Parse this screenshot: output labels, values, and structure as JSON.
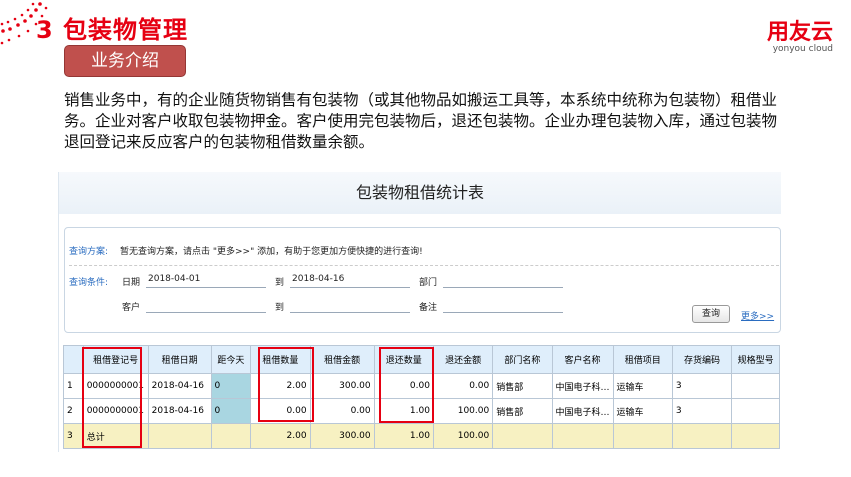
{
  "slide": {
    "title": "3  包装物管理",
    "section_label": "业务介绍",
    "logo_cn": "用友云",
    "logo_en": "yonyou cloud",
    "description": "销售业务中，有的企业随货物销售有包装物（或其他物品如搬运工具等，本系统中统称为包装物）租借业务。企业对客户收取包装物押金。客户使用完包装物后，退还包装物。企业办理包装物入库，通过包装物退回登记来反应客户的包装物租借数量余额。"
  },
  "report": {
    "title": "包装物租借统计表",
    "query": {
      "scheme_label": "查询方案:",
      "scheme_text": "暂无查询方案，请点击 \"更多>>\" 添加，有助于您更加方便快捷的进行查询!",
      "cond_label": "查询条件:",
      "date_label": "日期",
      "date_from": "2018-04-01",
      "to_label": "到",
      "date_to": "2018-04-16",
      "dept_label": "部门",
      "customer_label": "客户",
      "to_label2": "到",
      "remark_label": "备注",
      "query_button": "查询",
      "more_link": "更多>>"
    },
    "columns": [
      "",
      "租借登记号",
      "租借日期",
      "距今天",
      "租借数量",
      "租借金额",
      "退还数量",
      "退还金额",
      "部门名称",
      "客户名称",
      "租借项目",
      "存货编码",
      "规格型号"
    ],
    "rows": [
      [
        "1",
        "0000000001",
        "2018-04-16",
        "0",
        "2.00",
        "300.00",
        "0.00",
        "0.00",
        "销售部",
        "中国电子科…",
        "运输车",
        "3",
        ""
      ],
      [
        "2",
        "0000000001",
        "2018-04-16",
        "0",
        "0.00",
        "0.00",
        "1.00",
        "100.00",
        "销售部",
        "中国电子科…",
        "运输车",
        "3",
        ""
      ]
    ],
    "total": [
      "3",
      "总计",
      "",
      "",
      "2.00",
      "300.00",
      "1.00",
      "100.00",
      "",
      "",
      "",
      "",
      ""
    ],
    "highlight_color": "#e60012"
  }
}
